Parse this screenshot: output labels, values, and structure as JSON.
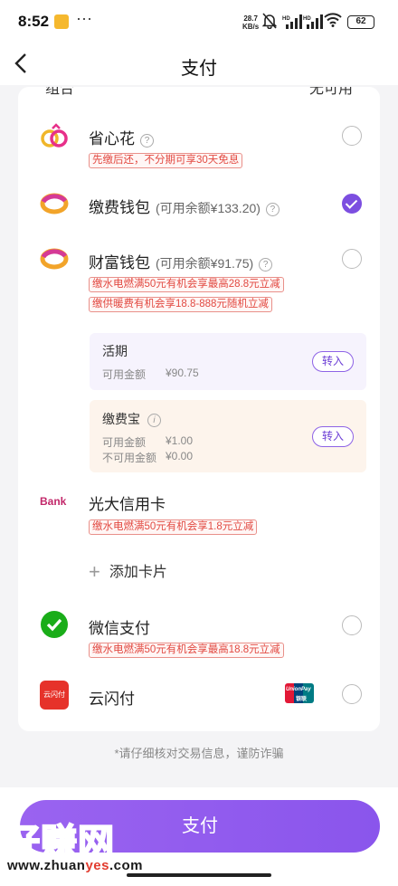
{
  "status_bar": {
    "time": "8:52",
    "net_speed_value": "28.7",
    "net_speed_unit": "KB/s",
    "signal_1_label": "HD",
    "signal_2_label": "HD",
    "battery": "62"
  },
  "nav": {
    "title": "支付"
  },
  "cut_off_row": {
    "left": "组合",
    "right": "无可用"
  },
  "methods": {
    "shengxinhua": {
      "name": "省心花",
      "promo": "先缴后还，不分期可享30天免息",
      "icon": "ring-logo-icon"
    },
    "jiaofei_wallet": {
      "name": "缴费钱包",
      "balance": "(可用余额¥133.20)",
      "icon": "wallet-logo-icon",
      "selected": true
    },
    "caifu_wallet": {
      "name": "财富钱包",
      "balance": "(可用余额¥91.75)",
      "promos": [
        "缴水电燃满50元有机会享最高28.8元立减",
        "缴供暖费有机会享18.8-888元随机立减"
      ],
      "icon": "wallet-logo-icon"
    },
    "huoqi": {
      "title": "活期",
      "label": "可用金额",
      "amount": "¥90.75",
      "button": "转入"
    },
    "jiaofeibao": {
      "title": "缴费宝",
      "available_label": "可用金额",
      "available_amount": "¥1.00",
      "unavailable_label": "不可用金额",
      "unavailable_amount": "¥0.00",
      "button": "转入"
    },
    "guangda": {
      "name": "光大信用卡",
      "bank_tag": "Bank",
      "promo": "缴水电燃满50元有机会享1.8元立减"
    },
    "add_card": {
      "label": "添加卡片"
    },
    "wechat": {
      "name": "微信支付",
      "promo": "缴水电燃满50元有机会享最高18.8元立减",
      "icon": "wechat-pay-icon"
    },
    "yunshanfu": {
      "name": "云闪付",
      "logo_text": "云闪付",
      "unionpay_text": "UnionPay",
      "unionpay_sub": "银联",
      "icon": "unionpay-icon"
    }
  },
  "notice": "*请仔细核对交易信息，谨防诈骗",
  "pay_button": "支付",
  "watermark": {
    "logo": "好赚网",
    "url_prefix": "www.zhuan",
    "url_highlight": "yes",
    "url_suffix": ".com"
  },
  "colors": {
    "accent": "#8a55ec",
    "promo_red": "#e24a42"
  }
}
